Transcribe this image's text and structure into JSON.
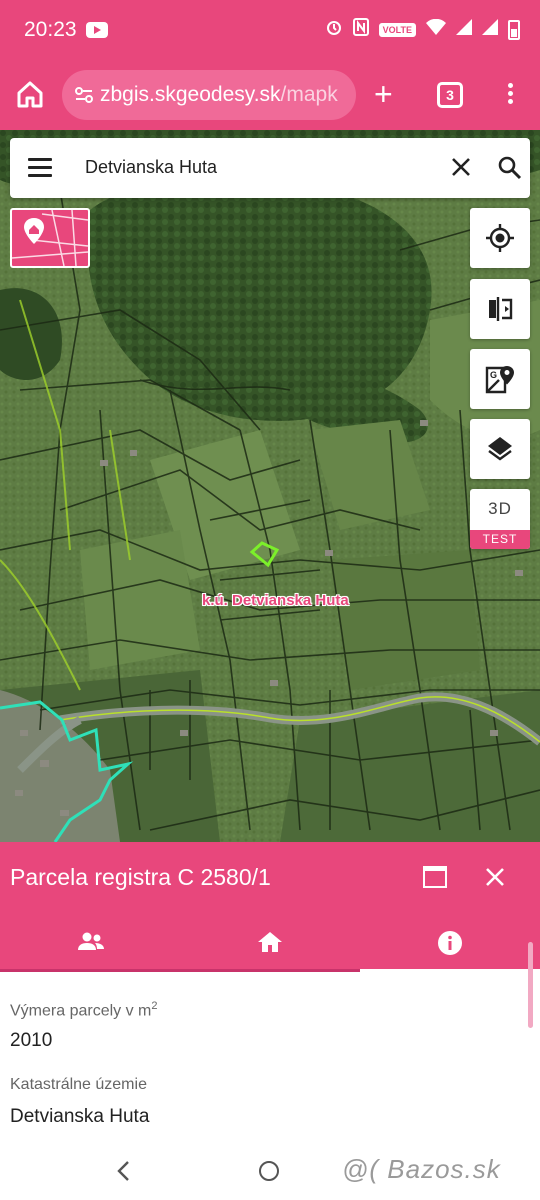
{
  "status_bar": {
    "time": "20:23",
    "volte": "VOLTE"
  },
  "browser": {
    "url_main": "zbgis.skgeodesy.sk",
    "url_rest": "/mapk",
    "tab_count": "3"
  },
  "search": {
    "query": "Detvianska Huta"
  },
  "map": {
    "cadastre_label": "k.ú. Detvianska Huta",
    "btn_3d": "3D",
    "btn_3d_tag": "TEST"
  },
  "panel": {
    "title": "Parcela registra C 2580/1",
    "tabs": [
      "owners",
      "building",
      "info"
    ],
    "active_tab": "info",
    "area_label": "Výmera parcely v m",
    "area_label_sup": "2",
    "area_value": "2010",
    "territory_label": "Katastrálne územie",
    "territory_value": "Detvianska Huta"
  },
  "watermark": "@( Bazos.sk",
  "colors": {
    "accent": "#e8477c",
    "forest": "#3a5a2c",
    "meadow": "#5d7a45",
    "parcel_highlight": "#7cf02a",
    "boundary": "#2fe0b8"
  }
}
